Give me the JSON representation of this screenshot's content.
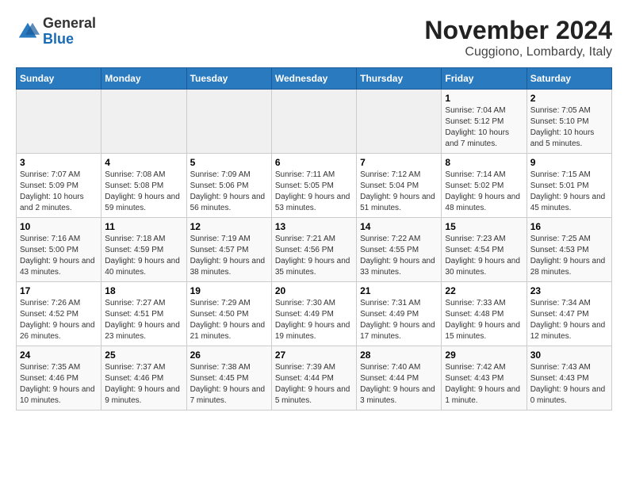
{
  "logo": {
    "general": "General",
    "blue": "Blue"
  },
  "title": "November 2024",
  "subtitle": "Cuggiono, Lombardy, Italy",
  "headers": [
    "Sunday",
    "Monday",
    "Tuesday",
    "Wednesday",
    "Thursday",
    "Friday",
    "Saturday"
  ],
  "weeks": [
    [
      {
        "day": "",
        "info": ""
      },
      {
        "day": "",
        "info": ""
      },
      {
        "day": "",
        "info": ""
      },
      {
        "day": "",
        "info": ""
      },
      {
        "day": "",
        "info": ""
      },
      {
        "day": "1",
        "info": "Sunrise: 7:04 AM\nSunset: 5:12 PM\nDaylight: 10 hours and 7 minutes."
      },
      {
        "day": "2",
        "info": "Sunrise: 7:05 AM\nSunset: 5:10 PM\nDaylight: 10 hours and 5 minutes."
      }
    ],
    [
      {
        "day": "3",
        "info": "Sunrise: 7:07 AM\nSunset: 5:09 PM\nDaylight: 10 hours and 2 minutes."
      },
      {
        "day": "4",
        "info": "Sunrise: 7:08 AM\nSunset: 5:08 PM\nDaylight: 9 hours and 59 minutes."
      },
      {
        "day": "5",
        "info": "Sunrise: 7:09 AM\nSunset: 5:06 PM\nDaylight: 9 hours and 56 minutes."
      },
      {
        "day": "6",
        "info": "Sunrise: 7:11 AM\nSunset: 5:05 PM\nDaylight: 9 hours and 53 minutes."
      },
      {
        "day": "7",
        "info": "Sunrise: 7:12 AM\nSunset: 5:04 PM\nDaylight: 9 hours and 51 minutes."
      },
      {
        "day": "8",
        "info": "Sunrise: 7:14 AM\nSunset: 5:02 PM\nDaylight: 9 hours and 48 minutes."
      },
      {
        "day": "9",
        "info": "Sunrise: 7:15 AM\nSunset: 5:01 PM\nDaylight: 9 hours and 45 minutes."
      }
    ],
    [
      {
        "day": "10",
        "info": "Sunrise: 7:16 AM\nSunset: 5:00 PM\nDaylight: 9 hours and 43 minutes."
      },
      {
        "day": "11",
        "info": "Sunrise: 7:18 AM\nSunset: 4:59 PM\nDaylight: 9 hours and 40 minutes."
      },
      {
        "day": "12",
        "info": "Sunrise: 7:19 AM\nSunset: 4:57 PM\nDaylight: 9 hours and 38 minutes."
      },
      {
        "day": "13",
        "info": "Sunrise: 7:21 AM\nSunset: 4:56 PM\nDaylight: 9 hours and 35 minutes."
      },
      {
        "day": "14",
        "info": "Sunrise: 7:22 AM\nSunset: 4:55 PM\nDaylight: 9 hours and 33 minutes."
      },
      {
        "day": "15",
        "info": "Sunrise: 7:23 AM\nSunset: 4:54 PM\nDaylight: 9 hours and 30 minutes."
      },
      {
        "day": "16",
        "info": "Sunrise: 7:25 AM\nSunset: 4:53 PM\nDaylight: 9 hours and 28 minutes."
      }
    ],
    [
      {
        "day": "17",
        "info": "Sunrise: 7:26 AM\nSunset: 4:52 PM\nDaylight: 9 hours and 26 minutes."
      },
      {
        "day": "18",
        "info": "Sunrise: 7:27 AM\nSunset: 4:51 PM\nDaylight: 9 hours and 23 minutes."
      },
      {
        "day": "19",
        "info": "Sunrise: 7:29 AM\nSunset: 4:50 PM\nDaylight: 9 hours and 21 minutes."
      },
      {
        "day": "20",
        "info": "Sunrise: 7:30 AM\nSunset: 4:49 PM\nDaylight: 9 hours and 19 minutes."
      },
      {
        "day": "21",
        "info": "Sunrise: 7:31 AM\nSunset: 4:49 PM\nDaylight: 9 hours and 17 minutes."
      },
      {
        "day": "22",
        "info": "Sunrise: 7:33 AM\nSunset: 4:48 PM\nDaylight: 9 hours and 15 minutes."
      },
      {
        "day": "23",
        "info": "Sunrise: 7:34 AM\nSunset: 4:47 PM\nDaylight: 9 hours and 12 minutes."
      }
    ],
    [
      {
        "day": "24",
        "info": "Sunrise: 7:35 AM\nSunset: 4:46 PM\nDaylight: 9 hours and 10 minutes."
      },
      {
        "day": "25",
        "info": "Sunrise: 7:37 AM\nSunset: 4:46 PM\nDaylight: 9 hours and 9 minutes."
      },
      {
        "day": "26",
        "info": "Sunrise: 7:38 AM\nSunset: 4:45 PM\nDaylight: 9 hours and 7 minutes."
      },
      {
        "day": "27",
        "info": "Sunrise: 7:39 AM\nSunset: 4:44 PM\nDaylight: 9 hours and 5 minutes."
      },
      {
        "day": "28",
        "info": "Sunrise: 7:40 AM\nSunset: 4:44 PM\nDaylight: 9 hours and 3 minutes."
      },
      {
        "day": "29",
        "info": "Sunrise: 7:42 AM\nSunset: 4:43 PM\nDaylight: 9 hours and 1 minute."
      },
      {
        "day": "30",
        "info": "Sunrise: 7:43 AM\nSunset: 4:43 PM\nDaylight: 9 hours and 0 minutes."
      }
    ]
  ]
}
